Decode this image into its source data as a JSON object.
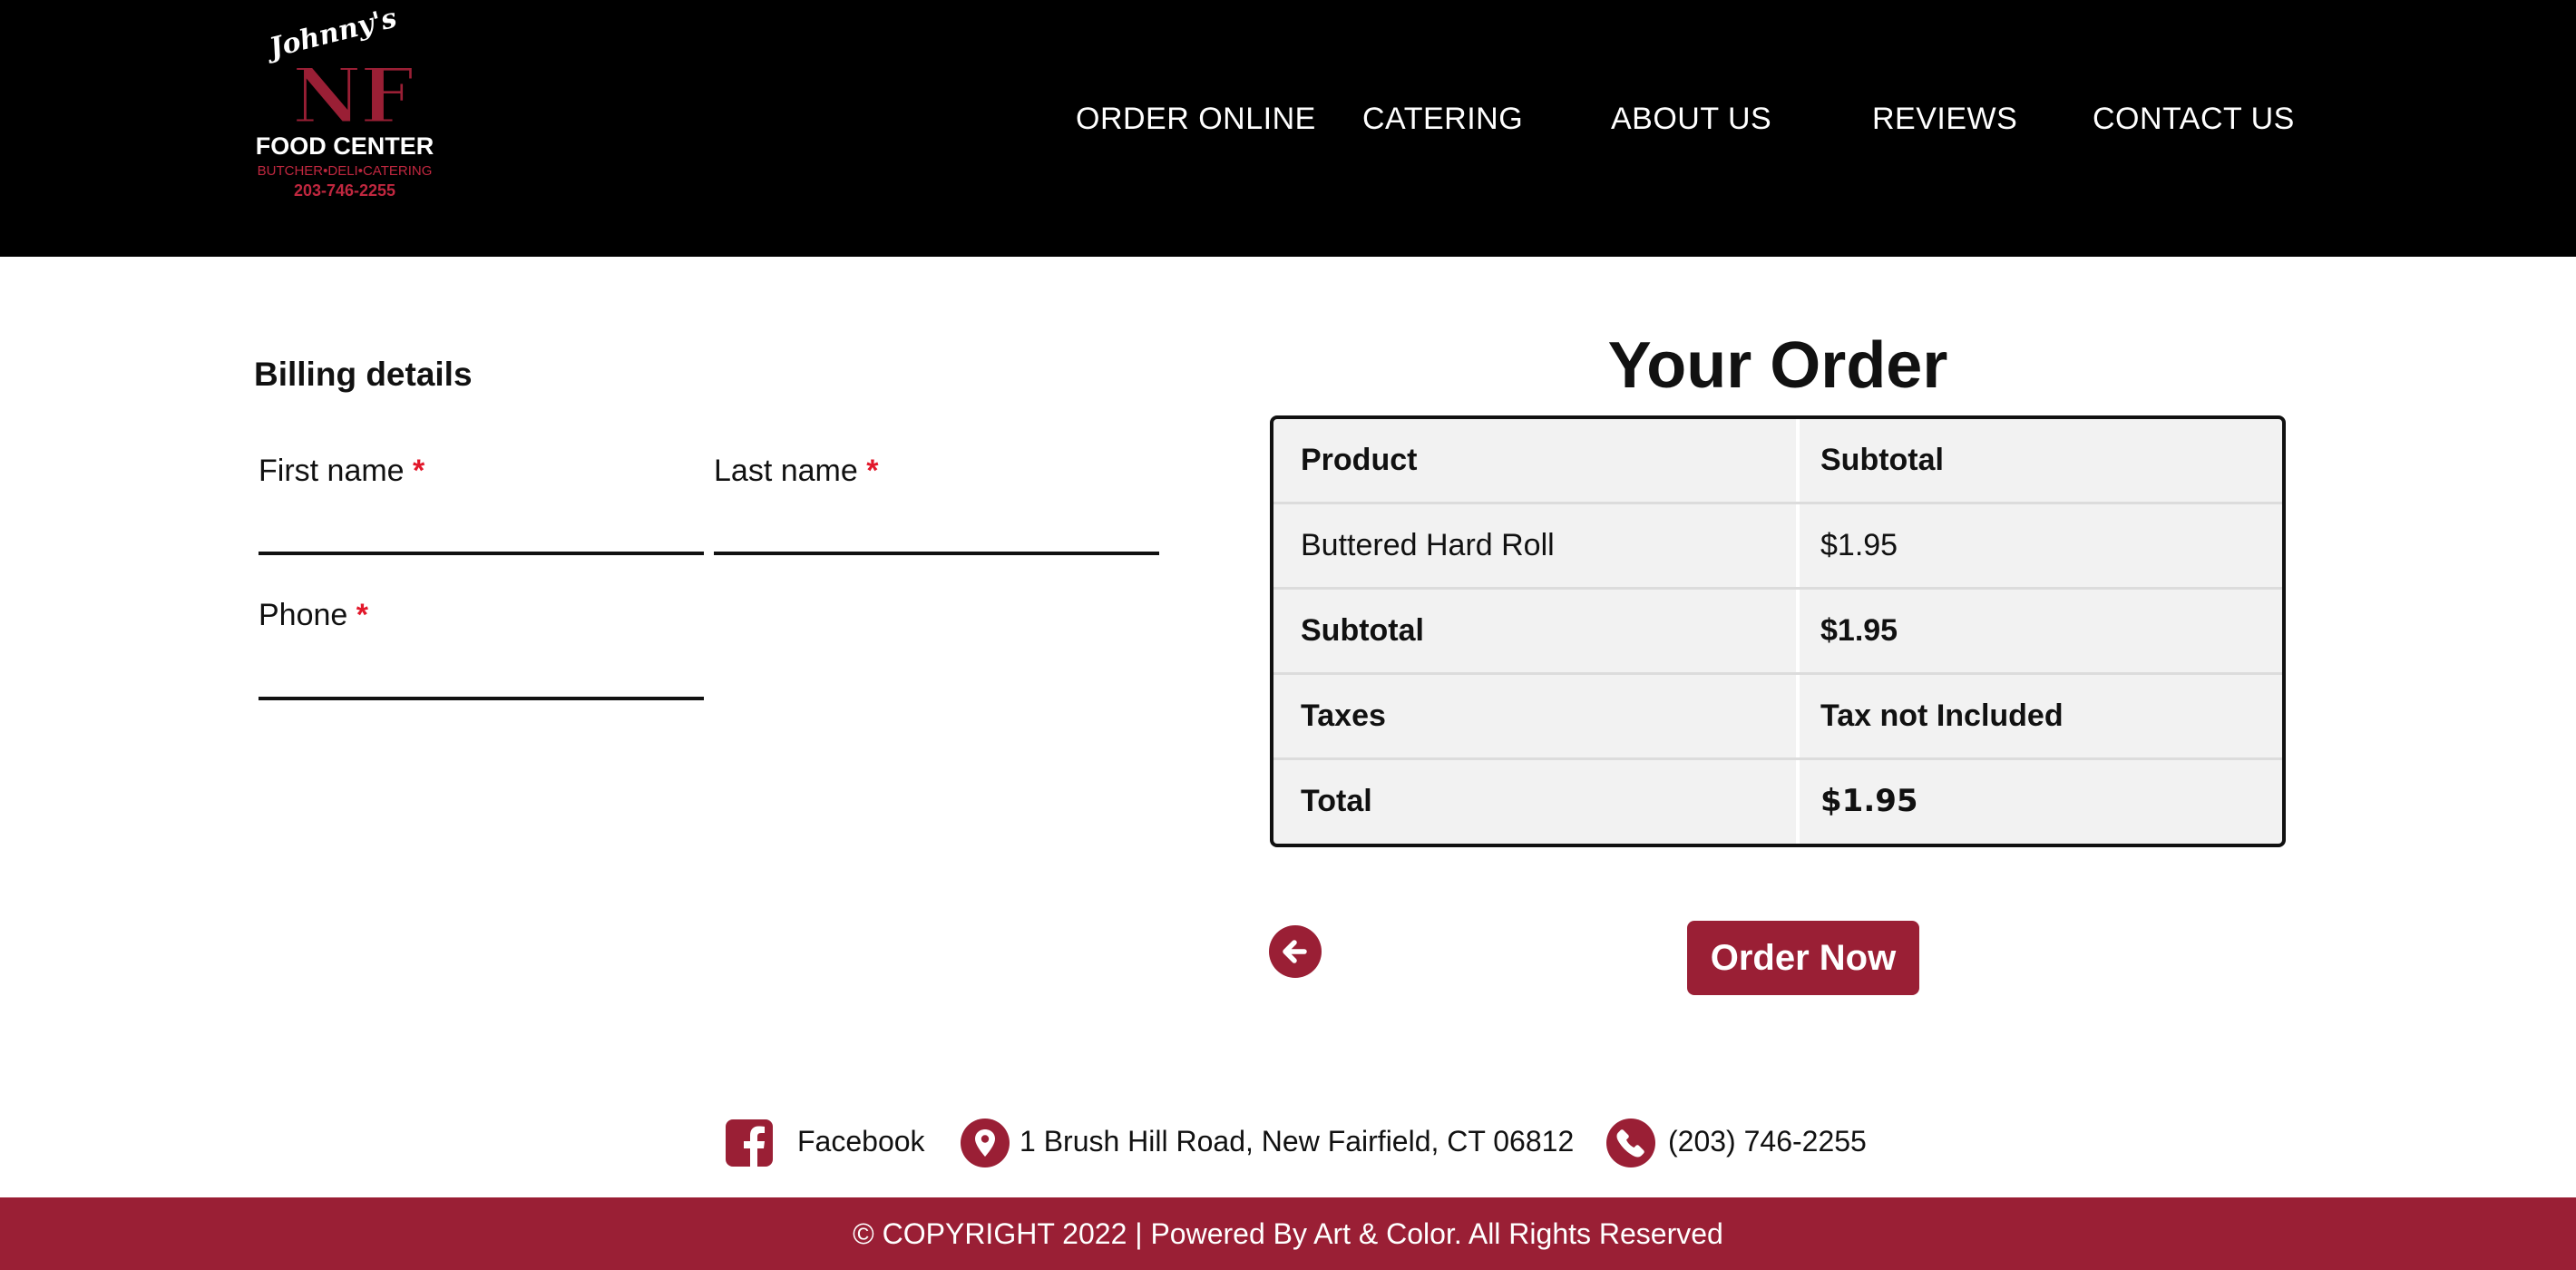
{
  "brand": {
    "script_name": "Johnny's",
    "initials": "NF",
    "name": "FOOD CENTER",
    "tagline": "BUTCHER•DELI•CATERING",
    "phone": "203-746-2255"
  },
  "nav": {
    "items": [
      {
        "label": "ORDER ONLINE"
      },
      {
        "label": "CATERING"
      },
      {
        "label": "ABOUT US"
      },
      {
        "label": "REVIEWS"
      },
      {
        "label": "CONTACT US"
      }
    ]
  },
  "billing": {
    "title": "Billing details",
    "required_mark": "*",
    "fields": {
      "first_name": {
        "label": "First name",
        "value": ""
      },
      "last_name": {
        "label": "Last name",
        "value": ""
      },
      "phone": {
        "label": "Phone",
        "value": ""
      }
    }
  },
  "order": {
    "title": "Your Order",
    "header": {
      "product": "Product",
      "subtotal": "Subtotal"
    },
    "items": [
      {
        "product": "Buttered Hard Roll",
        "subtotal": "$1.95"
      }
    ],
    "subtotal": {
      "label": "Subtotal",
      "value": "$1.95"
    },
    "taxes": {
      "label": "Taxes",
      "value": "Tax not Included"
    },
    "total": {
      "label": "Total",
      "value": "$1.95"
    },
    "order_button_label": "Order Now"
  },
  "footer": {
    "facebook_label": "Facebook",
    "address": "1 Brush Hill Road, New Fairfield, CT 06812",
    "phone": "(203) 746-2255",
    "copyright": "© COPYRIGHT 2022 | Powered By Art & Color. All Rights Reserved"
  },
  "colors": {
    "accent": "#9a1f35",
    "header_bg": "#000000",
    "required": "#e2182b",
    "table_bg": "#f2f2f2"
  },
  "icons": {
    "back": "arrow-left-circle-icon",
    "facebook": "facebook-icon",
    "location": "map-pin-icon",
    "phone": "phone-icon"
  }
}
